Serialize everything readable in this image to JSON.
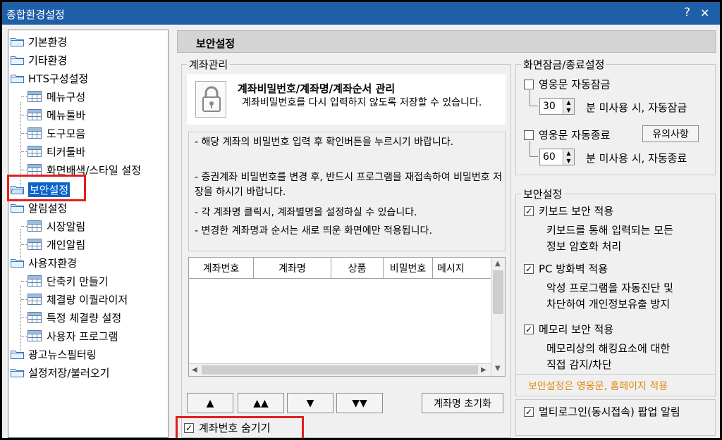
{
  "window": {
    "title": "종합환경설정",
    "help_glyph": "?",
    "close_glyph": "✕"
  },
  "tree": {
    "items": [
      {
        "label": "기본환경"
      },
      {
        "label": "기타환경"
      },
      {
        "label": "HTS구성설정"
      },
      {
        "label": "메뉴구성"
      },
      {
        "label": "메뉴툴바"
      },
      {
        "label": "도구모음"
      },
      {
        "label": "티커툴바"
      },
      {
        "label": "화면배색/스타일 설정"
      },
      {
        "label": "보안설정"
      },
      {
        "label": "알림설정"
      },
      {
        "label": "시장알림"
      },
      {
        "label": "개인알림"
      },
      {
        "label": "사용자환경"
      },
      {
        "label": "단축키 만들기"
      },
      {
        "label": "체결량 이퀄라이저"
      },
      {
        "label": "특정 체결량 설정"
      },
      {
        "label": "사용자 프로그램"
      },
      {
        "label": "광고뉴스필터링"
      },
      {
        "label": "설정저장/불러오기"
      }
    ]
  },
  "panel": {
    "title": "보안설정"
  },
  "account": {
    "group_label": "계좌관리",
    "header_title": "계좌비밀번호/계좌명/계좌순서 관리",
    "header_desc": "계좌비밀번호를 다시 입력하지 않도록 저장할 수 있습니다.",
    "notes": [
      "- 해당 계좌의 비밀번호 입력 후 확인버튼을 누르시기 바랍니다.",
      "- 증권계좌 비밀번호를 변경 후, 반드시 프로그램을 재접속하여 비밀번호 저장을 하시기 바랍니다.",
      "- 각 계좌명 클릭시, 계좌별명을 설정하실 수 있습니다.",
      "- 변경한 계좌명과 순서는 새로 띄운 화면에만 적용됩니다."
    ],
    "columns": [
      "계좌번호",
      "계좌명",
      "상품",
      "비밀번호",
      "메시지"
    ],
    "order_buttons": [
      "▲",
      "▲▲",
      "▼",
      "▼▼"
    ],
    "reset_button": "계좌명 초기화",
    "hide_checkbox": {
      "label": "계좌번호 숨기기",
      "checked": true
    }
  },
  "lock": {
    "group_label": "화면잠금/종료설정",
    "autolock": {
      "label": "영웅문 자동잠금",
      "checked": false,
      "minutes": "30",
      "suffix": "분 미사용 시, 자동잠금"
    },
    "autoexit": {
      "label": "영웅문 자동종료",
      "checked": false,
      "minutes": "60",
      "suffix": "분 미사용 시, 자동종료",
      "notice_button": "유의사항"
    }
  },
  "security": {
    "group_label": "보안설정",
    "items": [
      {
        "label": "키보드 보안 적용",
        "checked": true,
        "desc1": "키보드를 통해 입력되는 모든",
        "desc2": "정보 암호화 처리"
      },
      {
        "label": "PC 방화벽 적용",
        "checked": true,
        "desc1": "악성 프로그램을 자동진단 및",
        "desc2": "차단하여 개인정보유출 방지"
      },
      {
        "label": "메모리 보안 적용",
        "checked": true,
        "desc1": "메모리상의 해킹요소에 대한",
        "desc2": "직접 감지/차단"
      }
    ],
    "note": "보안설정은 영웅문, 홈페이지 적용",
    "multilogin": {
      "label": "멀티로그인(동시접속) 팝업 알림",
      "checked": true
    }
  },
  "colors": {
    "title_bar": "#1f5fa8",
    "selection": "#0a64c8",
    "highlight_box": "#e41e1e",
    "note_text": "#e08a10"
  }
}
